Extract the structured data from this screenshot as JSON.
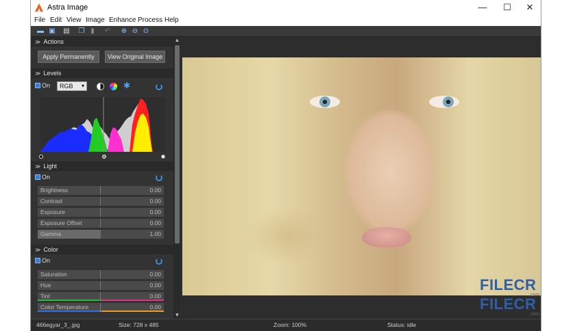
{
  "window": {
    "title": "Astra Image",
    "controls": {
      "minimize": "—",
      "maximize": "☐",
      "close": "✕"
    }
  },
  "menu": [
    "File",
    "Edit",
    "View",
    "Image",
    "Enhance",
    "Process",
    "Help"
  ],
  "toolbar_icons": [
    "open-icon",
    "save-icon",
    "print-icon",
    "copy-icon",
    "paste-icon",
    "undo-icon",
    "zoom-in-icon",
    "zoom-out-icon",
    "zoom-fit-icon"
  ],
  "actions": {
    "header": "Actions",
    "apply_label": "Apply Permanently",
    "view_original_label": "View Original Image"
  },
  "levels": {
    "header": "Levels",
    "on_label": "On",
    "channel": "RGB"
  },
  "light": {
    "header": "Light",
    "on_label": "On",
    "sliders": [
      {
        "name": "Brightness",
        "value": "0.00"
      },
      {
        "name": "Contrast",
        "value": "0.00"
      },
      {
        "name": "Exposure",
        "value": "0.00"
      },
      {
        "name": "Exposure Offset",
        "value": "0.00"
      },
      {
        "name": "Gamma",
        "value": "1.00"
      }
    ]
  },
  "color": {
    "header": "Color",
    "on_label": "On",
    "sliders": [
      {
        "name": "Saturation",
        "value": "0.00"
      },
      {
        "name": "Hue",
        "value": "0.00"
      },
      {
        "name": "Tint",
        "value": "0.00"
      },
      {
        "name": "Color Temperature",
        "value": "0.00"
      }
    ]
  },
  "status": {
    "file": "466egyar_3_.jpg",
    "size": "Size: 728 x 485",
    "zoom": "Zoom: 100%",
    "state": "Status: idle"
  },
  "watermark": {
    "text": "FILECR",
    "domain": ".com"
  },
  "colors": {
    "accent": "#3a7bd5",
    "panel": "#333333",
    "histogram_red": "#ff2020",
    "histogram_yellow": "#ffee00",
    "histogram_blue": "#1a2cff",
    "histogram_green": "#22cc22",
    "histogram_magenta": "#ff30d0"
  }
}
